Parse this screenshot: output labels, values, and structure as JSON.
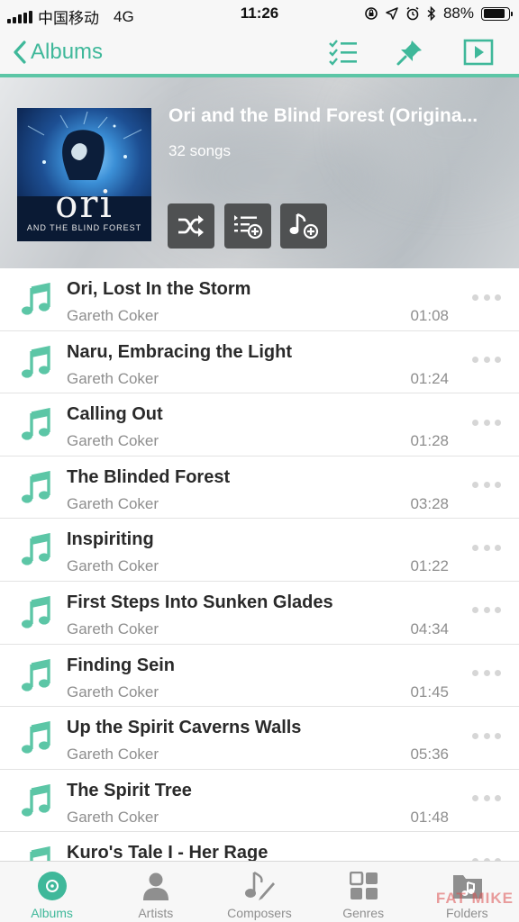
{
  "status_bar": {
    "carrier": "中国移动",
    "network": "4G",
    "time": "11:26",
    "battery": "88%",
    "battery_level": 0.88
  },
  "nav": {
    "back_label": "Albums",
    "icons": [
      "select-list-icon",
      "pin-icon",
      "play-icon"
    ]
  },
  "album": {
    "title": "Ori and the Blind Forest (Origina...",
    "song_count": "32 songs",
    "art_title": "ori",
    "art_subtitle": "AND THE BLIND FOREST",
    "actions": [
      "shuffle-icon",
      "add-to-queue-icon",
      "add-to-playlist-icon"
    ]
  },
  "songs": [
    {
      "title": "Ori, Lost In the Storm",
      "artist": "Gareth Coker",
      "duration": "01:08"
    },
    {
      "title": "Naru, Embracing the Light",
      "artist": "Gareth Coker",
      "duration": "01:24"
    },
    {
      "title": "Calling Out",
      "artist": "Gareth Coker",
      "duration": "01:28"
    },
    {
      "title": "The Blinded Forest",
      "artist": "Gareth Coker",
      "duration": "03:28"
    },
    {
      "title": "Inspiriting",
      "artist": "Gareth Coker",
      "duration": "01:22"
    },
    {
      "title": "First Steps Into Sunken Glades",
      "artist": "Gareth Coker",
      "duration": "04:34"
    },
    {
      "title": "Finding Sein",
      "artist": "Gareth Coker",
      "duration": "01:45"
    },
    {
      "title": "Up the Spirit Caverns Walls",
      "artist": "Gareth Coker",
      "duration": "05:36"
    },
    {
      "title": "The Spirit Tree",
      "artist": "Gareth Coker",
      "duration": "01:48"
    },
    {
      "title": "Kuro's Tale I - Her Rage",
      "artist": "",
      "duration": ""
    }
  ],
  "tabs": [
    {
      "label": "Albums",
      "icon": "disc-icon",
      "active": true
    },
    {
      "label": "Artists",
      "icon": "person-icon",
      "active": false
    },
    {
      "label": "Composers",
      "icon": "composer-icon",
      "active": false
    },
    {
      "label": "Genres",
      "icon": "grid-icon",
      "active": false
    },
    {
      "label": "Folders",
      "icon": "folder-music-icon",
      "active": false
    }
  ],
  "watermark": "FAT MIKE",
  "colors": {
    "accent": "#3fb89a",
    "accent_light": "#5cc6a6",
    "text_secondary": "#8e8e8e"
  }
}
